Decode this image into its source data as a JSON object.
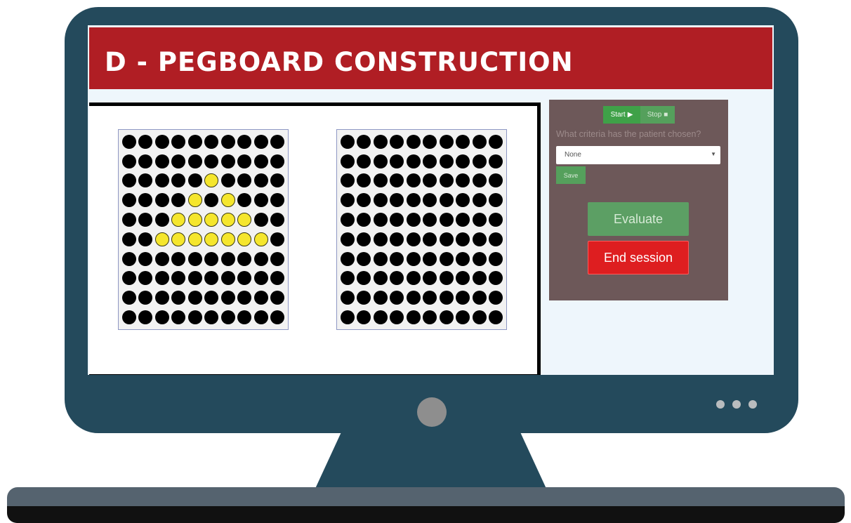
{
  "app": {
    "title": "D - PEGBOARD CONSTRUCTION"
  },
  "boards": {
    "rows": 10,
    "cols": 10,
    "left_yellow_pegs": [
      [
        2,
        5
      ],
      [
        3,
        4
      ],
      [
        3,
        6
      ],
      [
        4,
        3
      ],
      [
        4,
        4
      ],
      [
        4,
        5
      ],
      [
        4,
        6
      ],
      [
        4,
        7
      ],
      [
        5,
        2
      ],
      [
        5,
        3
      ],
      [
        5,
        4
      ],
      [
        5,
        5
      ],
      [
        5,
        6
      ],
      [
        5,
        7
      ],
      [
        5,
        8
      ]
    ],
    "right_yellow_pegs": [],
    "peg_color": "#000000",
    "highlight_color": "#f5e62d"
  },
  "controls": {
    "start_label": "Start",
    "start_icon": "play-icon",
    "stop_label": "Stop",
    "stop_icon": "stop-square-icon",
    "question": "What criteria has the patient chosen?",
    "criteria_select": {
      "value": "None",
      "caret_icon": "caret-down-icon"
    },
    "save_label": "Save",
    "evaluate_label": "Evaluate",
    "end_session_label": "End session"
  },
  "colors": {
    "header": "#b01e24",
    "panel": "#6d5859",
    "start": "#3fa148",
    "end_session": "#de1e20"
  }
}
